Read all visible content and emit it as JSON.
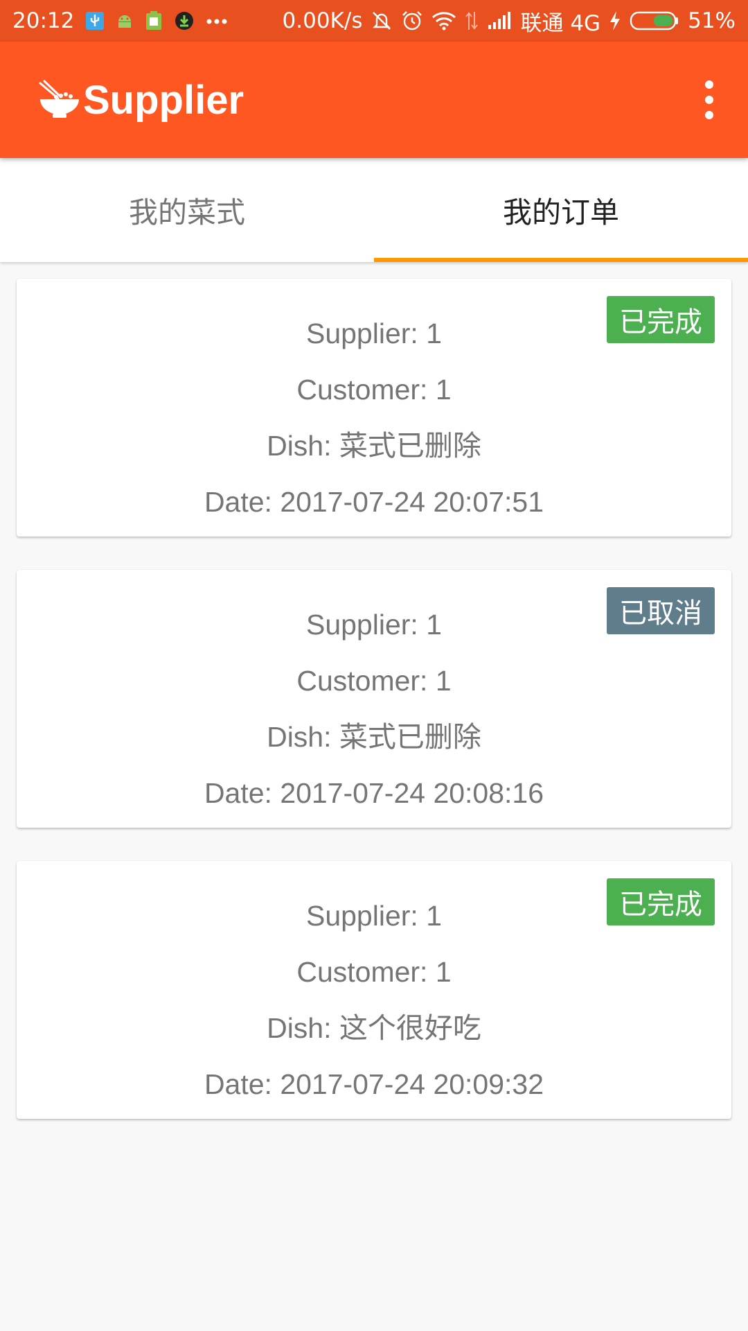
{
  "status_bar": {
    "time": "20:12",
    "net_speed": "0.00K/s",
    "carrier": "联通 4G",
    "battery": "51%",
    "icons": [
      "usb-icon",
      "android-icon",
      "battery-saver-icon",
      "download-icon",
      "more-dots-icon",
      "mute-icon",
      "alarm-icon",
      "wifi-icon",
      "data-arrows-icon",
      "signal-icon",
      "charging-icon",
      "battery-icon"
    ]
  },
  "toolbar": {
    "title": "Supplier",
    "logo_icon": "noodle-bowl-icon",
    "menu_icon": "more-vert-icon"
  },
  "tabs": [
    {
      "label": "我的菜式",
      "active": false
    },
    {
      "label": "我的订单",
      "active": true
    }
  ],
  "colors": {
    "status_bar": "#e8501f",
    "toolbar": "#ff5722",
    "tab_indicator": "#ff9800",
    "badge_done": "#4caf50",
    "badge_cancelled": "#607d8b"
  },
  "orders": [
    {
      "supplier": "Supplier: 1",
      "customer": "Customer: 1",
      "dish": "Dish: 菜式已删除",
      "date": "Date: 2017-07-24 20:07:51",
      "status": "已完成",
      "status_color": "#4caf50"
    },
    {
      "supplier": "Supplier: 1",
      "customer": "Customer: 1",
      "dish": "Dish: 菜式已删除",
      "date": "Date: 2017-07-24 20:08:16",
      "status": "已取消",
      "status_color": "#607d8b"
    },
    {
      "supplier": "Supplier: 1",
      "customer": "Customer: 1",
      "dish": "Dish: 这个很好吃",
      "date": "Date: 2017-07-24 20:09:32",
      "status": "已完成",
      "status_color": "#4caf50"
    }
  ]
}
